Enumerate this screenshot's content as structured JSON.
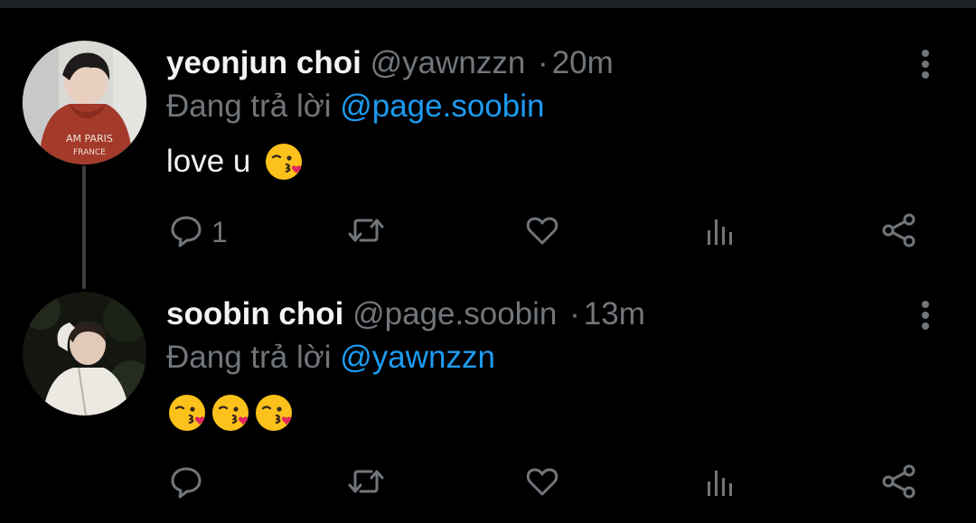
{
  "tweets": [
    {
      "name": "yeonjun choi",
      "handle": "@yawnzzn",
      "separator": "·",
      "time": "20m",
      "reply_prefix": "Đang trả lời",
      "reply_to": "@page.soobin",
      "text": "love u",
      "emojis": [
        "face-blowing-a-kiss"
      ],
      "reply_count": "1"
    },
    {
      "name": "soobin choi",
      "handle": "@page.soobin",
      "separator": "·",
      "time": "13m",
      "reply_prefix": "Đang trả lời",
      "reply_to": "@yawnzzn",
      "text": "",
      "emojis": [
        "face-blowing-a-kiss",
        "face-blowing-a-kiss",
        "face-blowing-a-kiss"
      ],
      "reply_count": ""
    }
  ],
  "icons": {
    "reply": "reply-icon",
    "retweet": "retweet-icon",
    "like": "heart-icon",
    "stats": "stats-icon",
    "share": "share-icon",
    "more": "more-vertical-icon"
  },
  "colors": {
    "background": "#000000",
    "text": "#f2f3f4",
    "secondary": "#71767b",
    "mention": "#1d9bf0",
    "thread_line": "#3a3e41"
  }
}
